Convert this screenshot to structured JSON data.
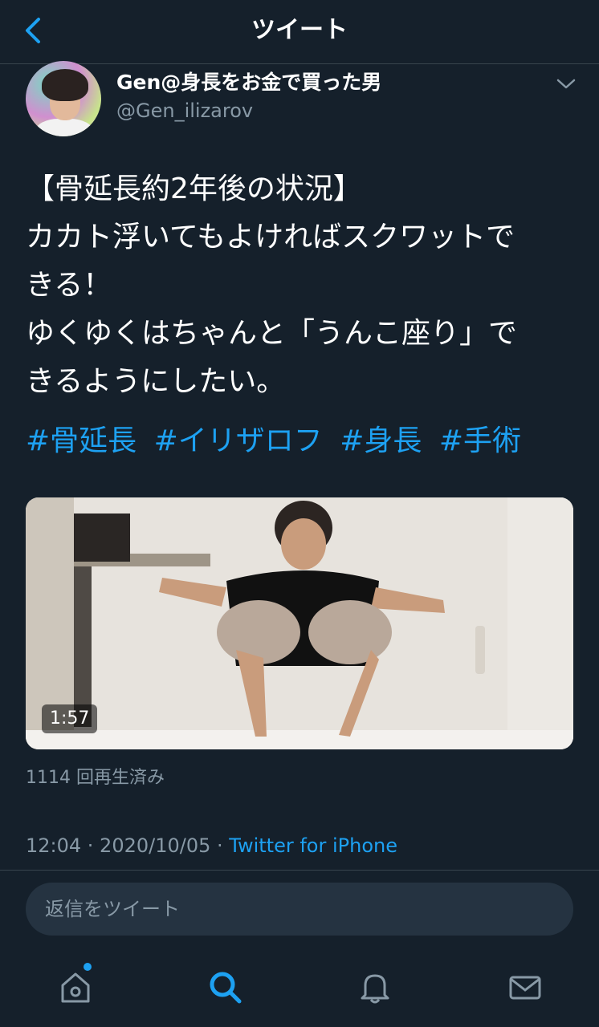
{
  "header": {
    "title": "ツイート"
  },
  "user": {
    "name": "Gen@身長をお金で買った男",
    "handle": "@Gen_ilizarov"
  },
  "tweet": {
    "lines": [
      "【骨延長約2年後の状況】",
      "カカト浮いてもよければスクワットで",
      "きる！",
      "ゆくゆくはちゃんと「うんこ座り」で",
      "きるようにしたい。"
    ],
    "hashtags": [
      "#骨延長",
      "#イリザロフ",
      "#身長",
      "#手術"
    ]
  },
  "video": {
    "duration": "1:57",
    "views": "1114 回再生済み"
  },
  "meta": {
    "time_date": "12:04 · 2020/10/05 · ",
    "source": "Twitter for iPhone"
  },
  "reply": {
    "placeholder": "返信をツイート"
  },
  "tabbar": {
    "items": [
      "home-icon",
      "search-icon",
      "notifications-icon",
      "messages-icon"
    ],
    "active": "search-icon"
  },
  "colors": {
    "background": "#15202b",
    "accent": "#1da1f2",
    "secondary_text": "#8899a6",
    "divider": "#38444d"
  }
}
